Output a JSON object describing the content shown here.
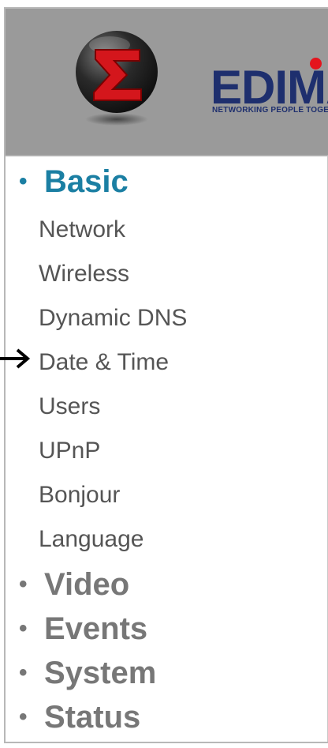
{
  "brand": {
    "name": "EDIMAX",
    "tagline": "NETWORKING PEOPLE TOGETHER"
  },
  "colors": {
    "header_bg": "#9a9a9a",
    "active_section": "#1b7fa3",
    "inactive_section": "#777777",
    "item_text": "#555555",
    "brand_blue": "#1e2f6e",
    "brand_red": "#e4141d"
  },
  "menu": {
    "bullet": "•",
    "basic": {
      "label": "Basic",
      "items": [
        "Network",
        "Wireless",
        "Dynamic DNS",
        "Date & Time",
        "Users",
        "UPnP",
        "Bonjour",
        "Language"
      ]
    },
    "video": {
      "label": "Video"
    },
    "events": {
      "label": "Events"
    },
    "system": {
      "label": "System"
    },
    "status": {
      "label": "Status"
    }
  },
  "pointer": {
    "icon": "arrow-right-icon",
    "target": "Date & Time"
  }
}
